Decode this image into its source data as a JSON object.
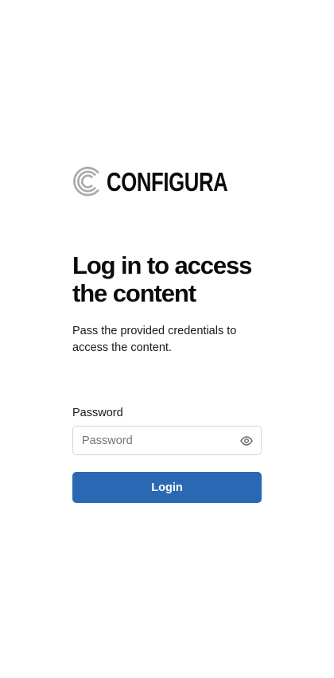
{
  "brand": {
    "name": "CONFIGURA",
    "logo_icon": "configura-c-logo-icon",
    "logo_color": "#a7a9ac"
  },
  "heading": "Log in to access the content",
  "subtext": "Pass the provided credentials to access the content.",
  "password_field": {
    "label": "Password",
    "placeholder": "Password",
    "value": "",
    "toggle_icon": "eye-icon"
  },
  "login_button": {
    "label": "Login",
    "color": "#2a68b4"
  }
}
